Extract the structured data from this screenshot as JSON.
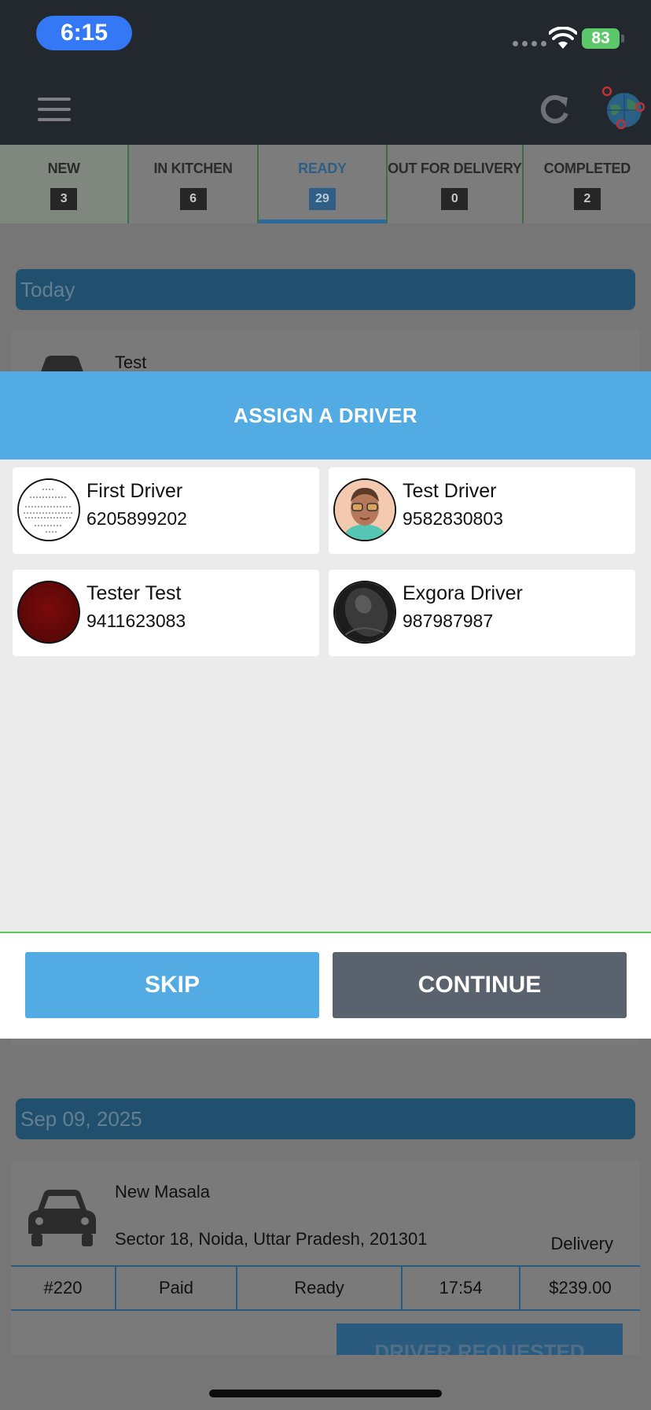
{
  "status_bar": {
    "time": "6:15",
    "battery": "83"
  },
  "header": {
    "menu_icon": "hamburger-menu-icon",
    "refresh_icon": "refresh-icon",
    "globe_icon": "globe-map-icon"
  },
  "tabs": [
    {
      "label": "NEW",
      "count": "3"
    },
    {
      "label": "IN KITCHEN",
      "count": "6"
    },
    {
      "label": "READY",
      "count": "29",
      "active": true
    },
    {
      "label": "OUT FOR DELIVERY",
      "count": "0"
    },
    {
      "label": "COMPLETED",
      "count": "2"
    }
  ],
  "background": {
    "section_today": "Today",
    "order_1_name": "Test",
    "section_date": "Sep 09, 2025",
    "order_2": {
      "name": "New Masala",
      "address": "Sector 18, Noida, Uttar Pradesh, 201301",
      "type": "Delivery",
      "number": "#220",
      "payment": "Paid",
      "status": "Ready",
      "time": "17:54",
      "total": "$239.00",
      "action": "DRIVER REQUESTED"
    }
  },
  "modal": {
    "title": "ASSIGN A DRIVER",
    "drivers": [
      {
        "name": "First Driver",
        "phone": "6205899202"
      },
      {
        "name": "Test Driver",
        "phone": "9582830803"
      },
      {
        "name": "Tester Test",
        "phone": "9411623083"
      },
      {
        "name": "Exgora Driver",
        "phone": "987987987"
      }
    ],
    "skip_label": "SKIP",
    "continue_label": "CONTINUE"
  },
  "colors": {
    "header_bg": "#23272e",
    "modal_accent": "#52abe3",
    "continue_bg": "#5a626e",
    "active_tab": "#2f5f86"
  }
}
